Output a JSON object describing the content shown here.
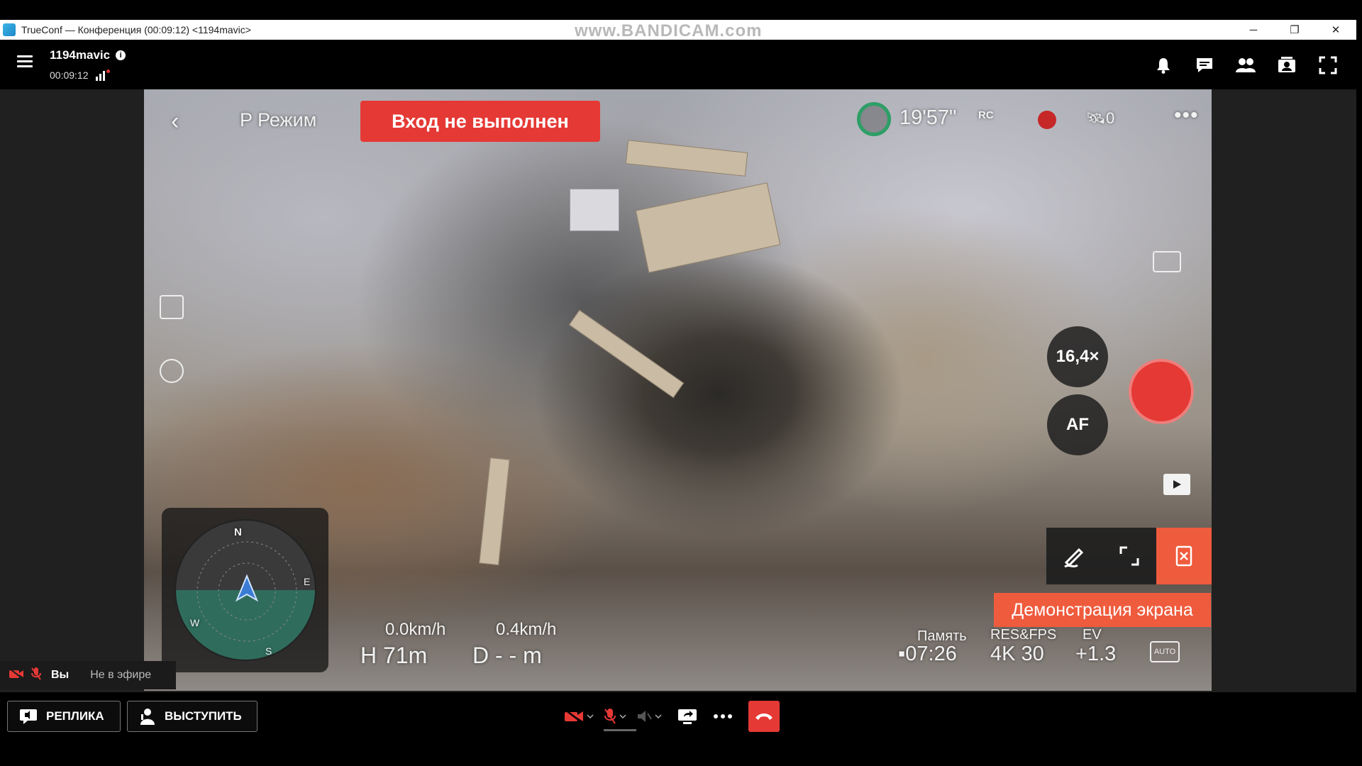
{
  "window": {
    "title": "TrueConf — Конференция (00:09:12) <1194mavic>",
    "watermark": "www.BANDICAM.com"
  },
  "header": {
    "conference_name": "1194mavic",
    "timer": "00:09:12"
  },
  "video_overlay": {
    "mode": "P Режим",
    "login_banner": "Вход не выполнен",
    "flight_time": "19'57\"",
    "rc_label": "RC",
    "satellites": "0",
    "zoom": "16,4×",
    "focus": "AF",
    "speed_h": "0.0km/h",
    "speed_v": "0.4km/h",
    "height": "H 71m",
    "distance": "D - - m",
    "memory_label": "Память",
    "memory_value": "07:26",
    "res_label": "RES&FPS",
    "res_value": "4K 30",
    "ev_label": "EV",
    "ev_value": "+1.3",
    "auto_label": "AUTO",
    "compass": {
      "n": "N",
      "e": "E",
      "s": "S",
      "w": "W"
    },
    "screen_share_banner": "Демонстрация экрана"
  },
  "self_tile": {
    "you_label": "Вы",
    "status": "Не в эфире"
  },
  "bottombar": {
    "reply_label": "РЕПЛИКА",
    "speak_label": "ВЫСТУПИТЬ"
  },
  "colors": {
    "accent_red": "#e53935",
    "share_orange": "#ef5b3d",
    "battery_green": "#2e9e66"
  },
  "icons": [
    "menu-icon",
    "info-icon",
    "signal-icon",
    "bell-icon",
    "chat-icon",
    "participants-icon",
    "content-icon",
    "fullscreen-icon",
    "camera-off-icon",
    "mic-off-icon",
    "speaker-icon",
    "screen-share-icon",
    "more-icon",
    "hangup-icon"
  ]
}
